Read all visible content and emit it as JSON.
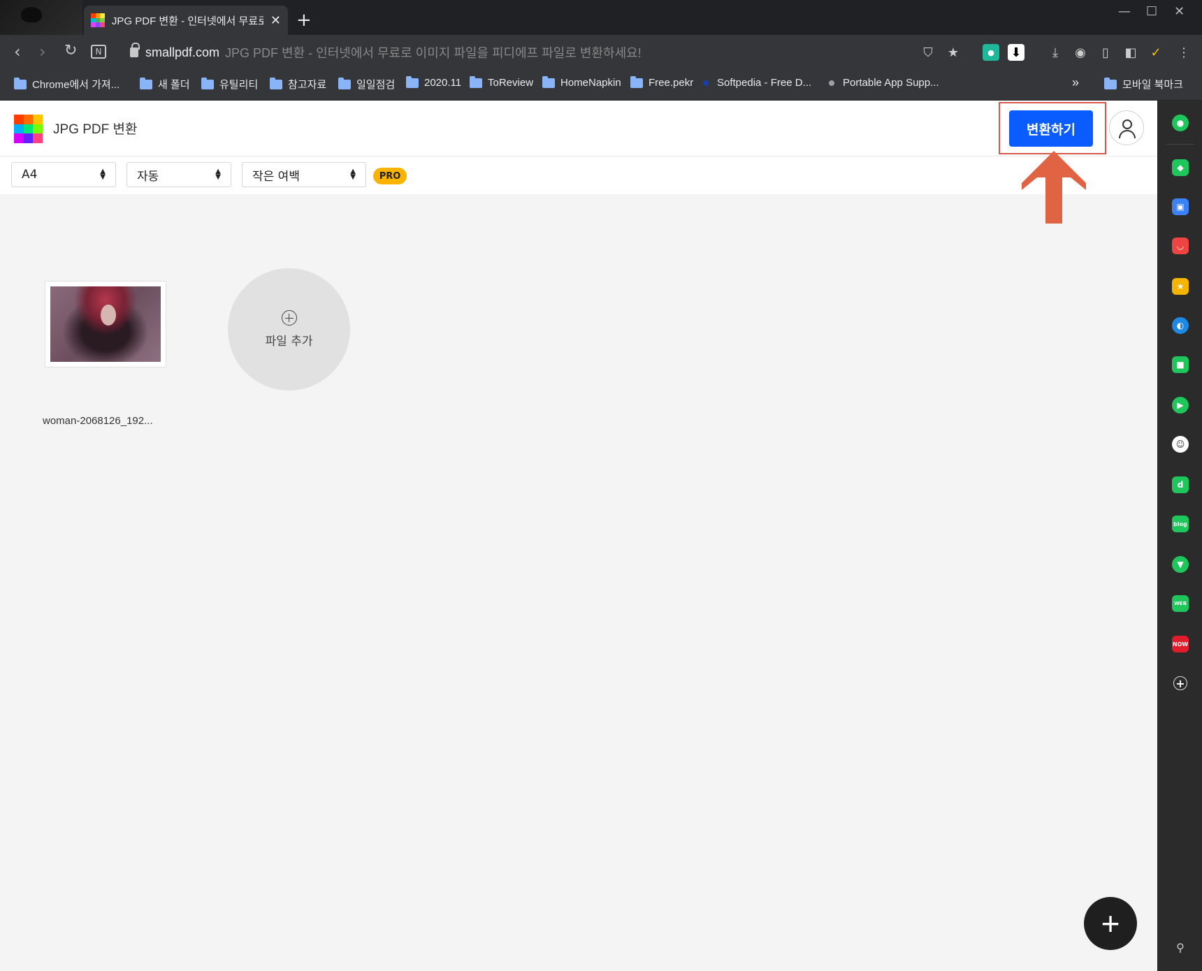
{
  "browser": {
    "tab_title": "JPG PDF 변환 - 인터넷에서 무료로",
    "tab_close": "✕",
    "new_tab": "+",
    "window_controls": [
      "—",
      "☐",
      "✕"
    ],
    "address": {
      "domain": "smallpdf.com",
      "title_text": "JPG PDF 변환 - 인터넷에서 무료로 이미지 파일을 피디에프 파일로 변환하세요!"
    },
    "bookmarks": [
      {
        "label": "Chrome에서 가져...",
        "type": "folder"
      },
      {
        "label": "새 폴더",
        "type": "folder"
      },
      {
        "label": "유틸리티",
        "type": "folder"
      },
      {
        "label": "참고자료",
        "type": "folder"
      },
      {
        "label": "일일점검",
        "type": "folder"
      },
      {
        "label": "2020.11",
        "type": "folder"
      },
      {
        "label": "ToReview",
        "type": "folder"
      },
      {
        "label": "HomeNapkin",
        "type": "folder"
      },
      {
        "label": "Free.pekr",
        "type": "folder"
      },
      {
        "label": "Softpedia - Free D...",
        "type": "site"
      },
      {
        "label": "Portable App Supp...",
        "type": "site"
      }
    ],
    "bookmarks_overflow": "»",
    "mobile_bookmarks": "모바일 북마크"
  },
  "app": {
    "title": "JPG PDF 변환",
    "convert_button": "변환하기",
    "options": {
      "page_size": "A4",
      "orientation": "자동",
      "margin": "작은 여백",
      "pro_badge": "PRO"
    },
    "files": [
      {
        "name": "woman-2068126_192..."
      }
    ],
    "add_file_label": "파일 추가",
    "fab_label": "+"
  },
  "colors": {
    "accent": "#0a5cff",
    "annotation": "#d9574a",
    "pro": "#f9b300"
  }
}
